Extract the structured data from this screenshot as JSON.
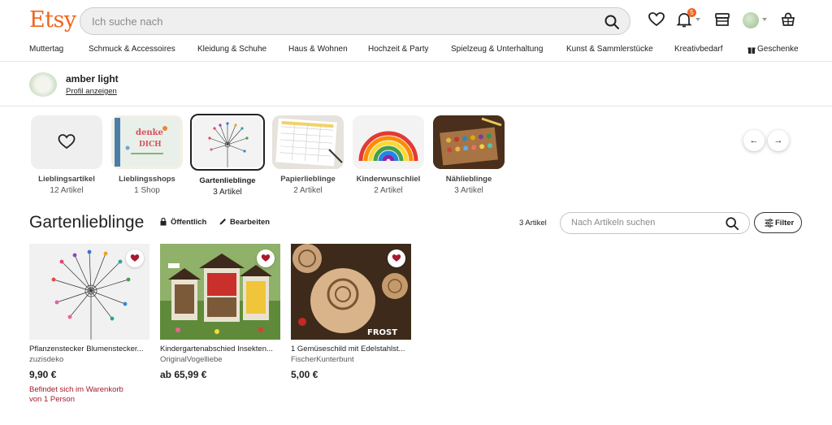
{
  "header": {
    "logo": "Etsy",
    "search_placeholder": "Ich suche nach",
    "notification_count": "5",
    "icons": [
      "search-icon",
      "heart-icon",
      "bell-icon",
      "shop-icon",
      "avatar",
      "basket-icon"
    ]
  },
  "nav": {
    "items": [
      "Muttertag",
      "Schmuck & Accessoires",
      "Kleidung & Schuhe",
      "Haus & Wohnen",
      "Hochzeit & Party",
      "Spielzeug & Unterhaltung",
      "Kunst & Sammlerstücke",
      "Kreativbedarf",
      "Geschenke"
    ]
  },
  "profile": {
    "name": "amber light",
    "link": "Profil anzeigen"
  },
  "collections": [
    {
      "title": "Lieblingsartikel",
      "count": "12 Artikel"
    },
    {
      "title": "Lieblingsshops",
      "count": "1 Shop"
    },
    {
      "title": "Gartenlieblinge",
      "count": "3 Artikel"
    },
    {
      "title": "Papierlieblinge",
      "count": "2 Artikel"
    },
    {
      "title": "Kinderwunschliel",
      "count": "2 Artikel"
    },
    {
      "title": "Nählieblinge",
      "count": "3 Artikel"
    }
  ],
  "collection": {
    "title": "Gartenlieblinge",
    "visibility": "Öffentlich",
    "edit": "Bearbeiten",
    "count": "3 Artikel",
    "search_placeholder": "Nach Artikeln suchen",
    "filter": "Filter"
  },
  "listings": [
    {
      "title": "Pflanzenstecker Blumenstecker...",
      "shop": "zuzisdeko",
      "price": "9,90 €",
      "note": "Befindet sich im Warenkorb von 1 Person"
    },
    {
      "title": "Kindergartenabschied Insekten...",
      "shop": "OriginalVogelliebe",
      "price": "ab 65,99 €",
      "note": ""
    },
    {
      "title": "1 Gemüseschild mit Edelstahlst...",
      "shop": "FischerKunterbunt",
      "price": "5,00 €",
      "note": ""
    }
  ],
  "colors": {
    "brand": "#f1641e",
    "favorite": "#a61a2e"
  }
}
